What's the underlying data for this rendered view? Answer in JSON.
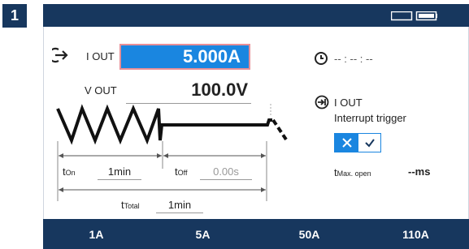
{
  "step": "1",
  "top_left": {
    "iout_label": "I OUT",
    "iout_value": "5.000A",
    "vout_label": "V OUT",
    "vout_value": "100.0V"
  },
  "timing": {
    "t_on_label": "t",
    "t_on_sub": "On",
    "t_on_value": "1min",
    "t_off_label": "t",
    "t_off_sub": "Off",
    "t_off_value": "0.00s",
    "t_total_label": "t",
    "t_total_sub": "Total",
    "t_total_value": "1min"
  },
  "right_panel": {
    "clock_value": "-- : -- : --",
    "interrupt_label": "I OUT",
    "interrupt_desc": "Interrupt trigger",
    "t_max_label": "t",
    "t_max_sub": "Max. open",
    "t_max_value": "--ms"
  },
  "presets": [
    "1A",
    "5A",
    "50A",
    "110A"
  ],
  "colors": {
    "bar": "#17375e",
    "highlight": "#1a86e0",
    "highlight_border": "#e88f97"
  }
}
